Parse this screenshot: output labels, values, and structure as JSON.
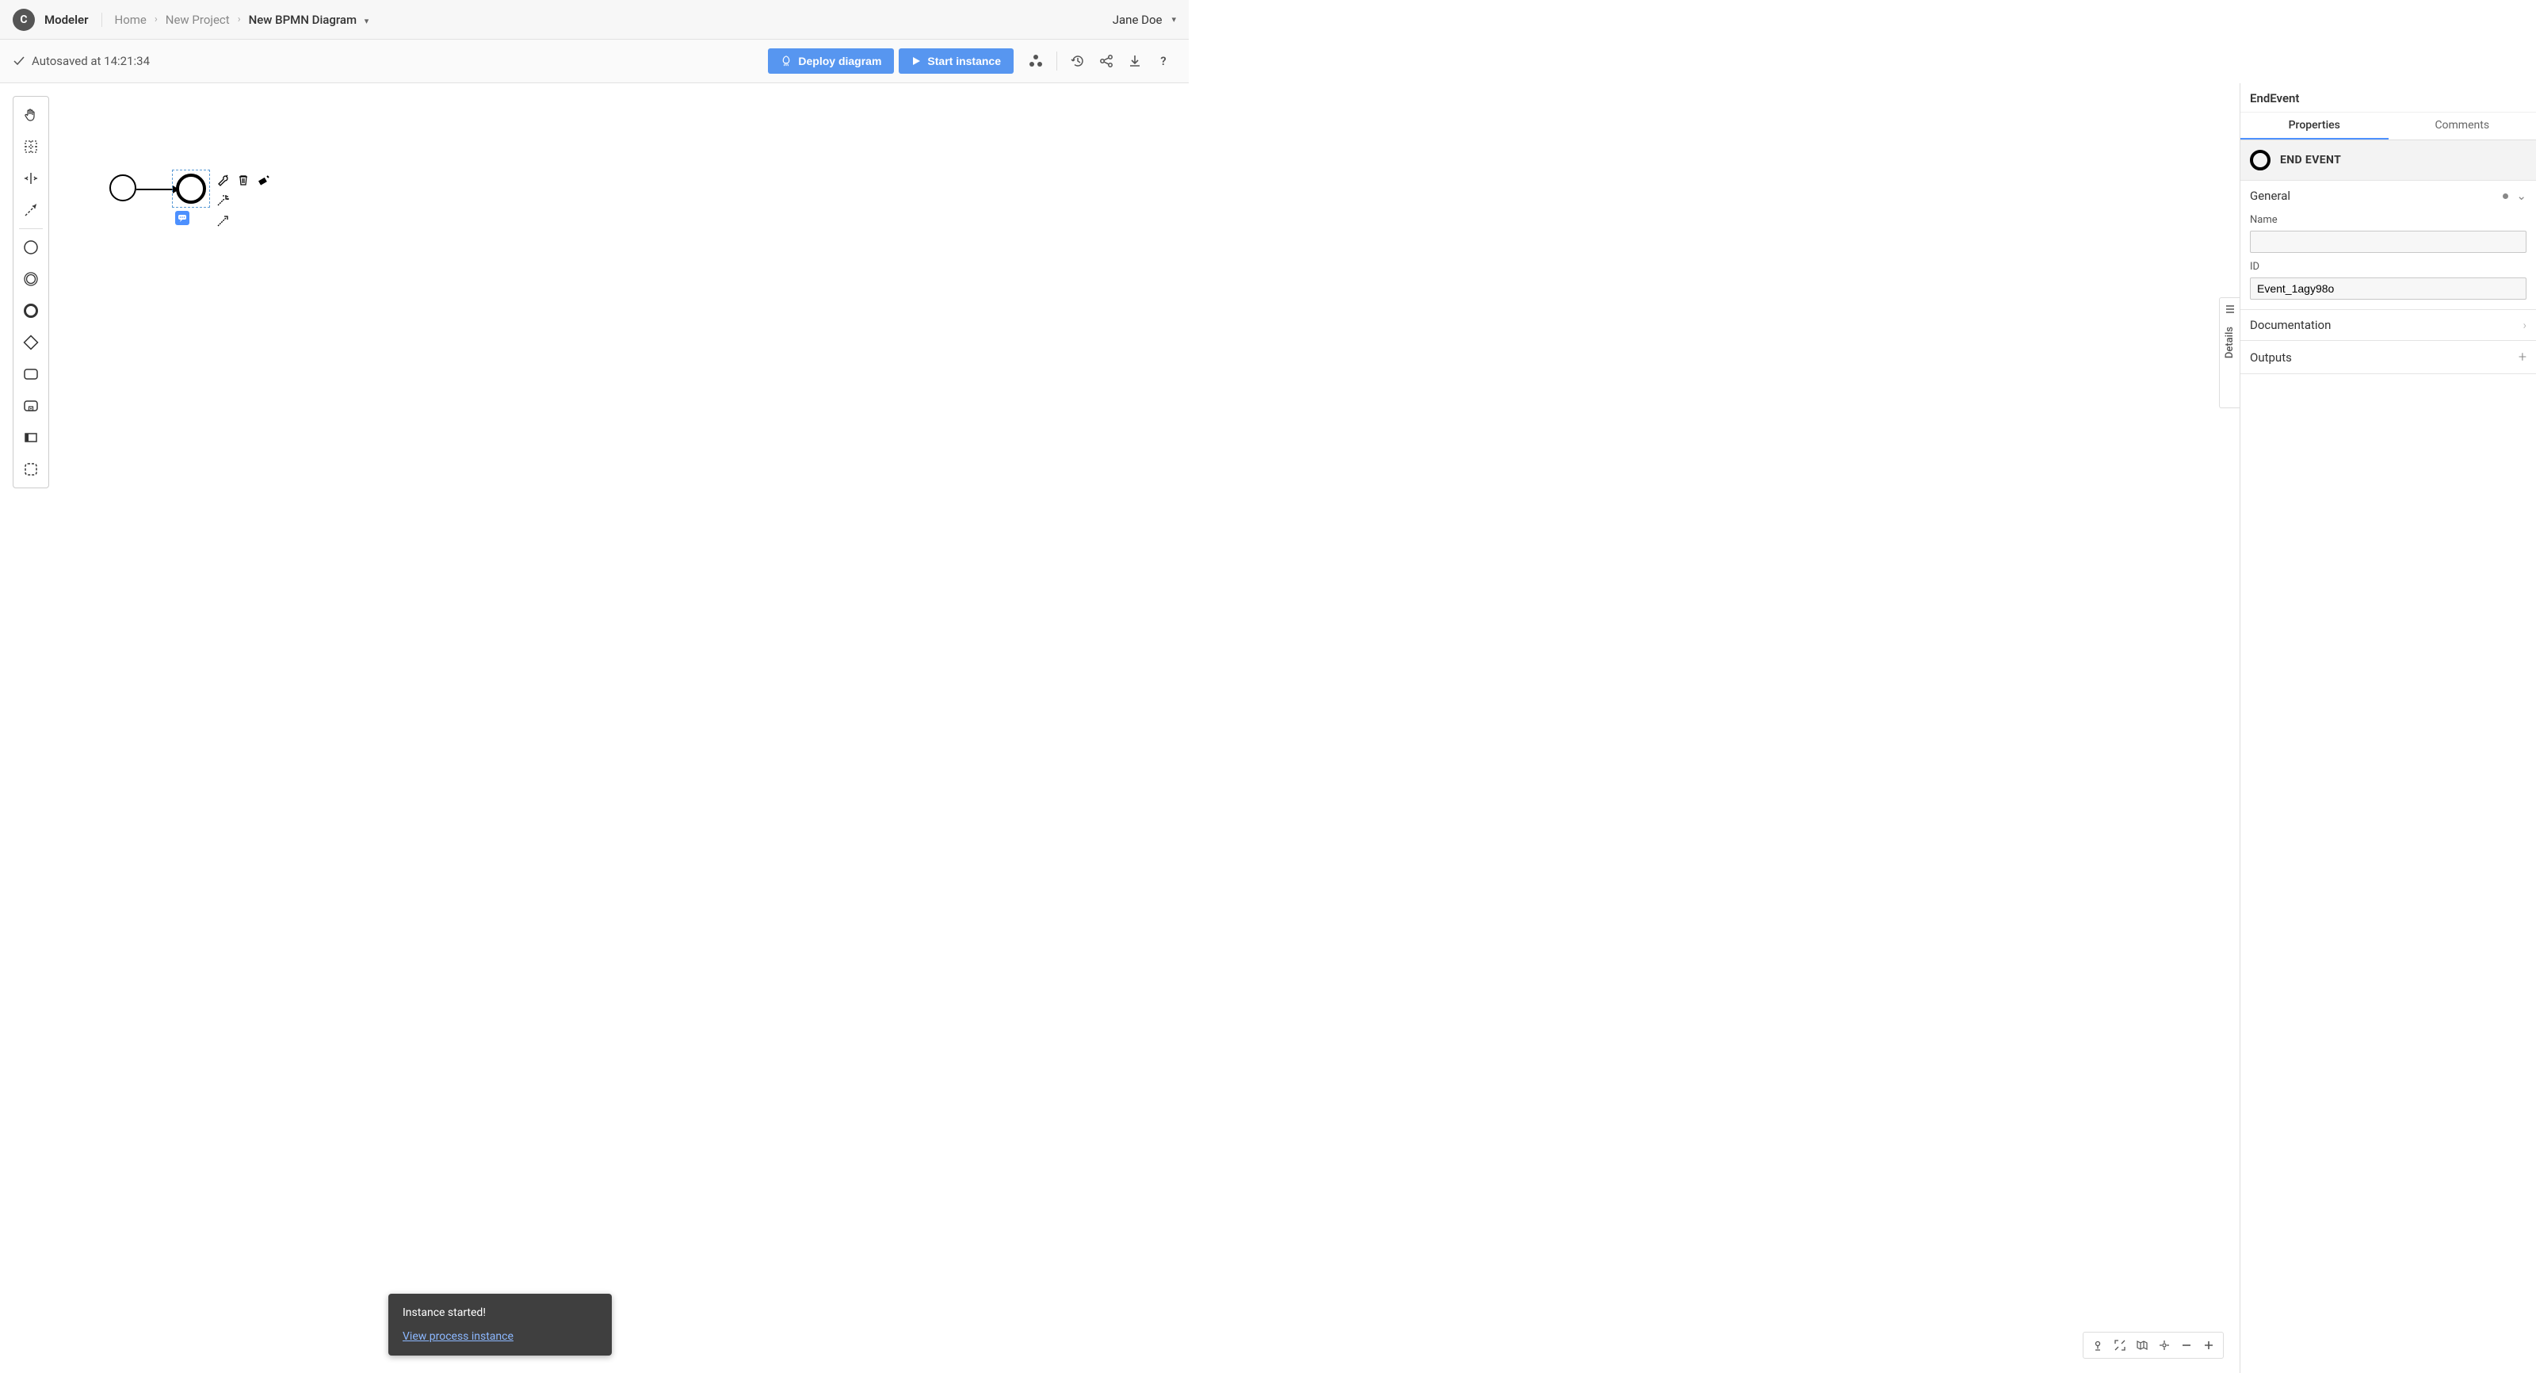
{
  "app": {
    "name": "Modeler",
    "logo_letter": "C"
  },
  "breadcrumb": {
    "home": "Home",
    "project": "New Project",
    "diagram": "New BPMN Diagram"
  },
  "user": {
    "name": "Jane Doe"
  },
  "autosave": {
    "text": "Autosaved at 14:21:34"
  },
  "actions": {
    "deploy": "Deploy diagram",
    "start": "Start instance"
  },
  "details_handle": {
    "label": "Details"
  },
  "properties": {
    "element_type": "EndEvent",
    "tabs": {
      "properties": "Properties",
      "comments": "Comments"
    },
    "type_label": "END EVENT",
    "groups": {
      "general": {
        "title": "General",
        "name_label": "Name",
        "name_value": "",
        "id_label": "ID",
        "id_value": "Event_1agy98o"
      },
      "documentation": {
        "title": "Documentation"
      },
      "outputs": {
        "title": "Outputs"
      }
    }
  },
  "toast": {
    "title": "Instance started!",
    "link": "View process instance"
  }
}
